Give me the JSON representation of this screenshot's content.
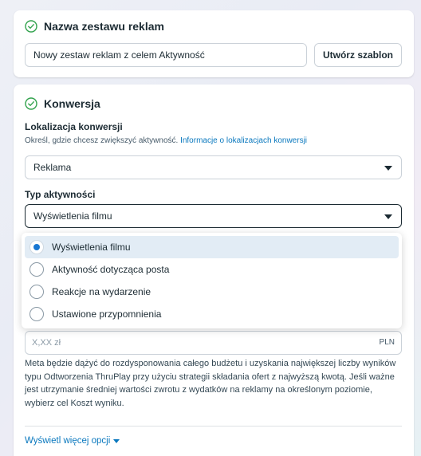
{
  "ad_set_name": {
    "title": "Nazwa zestawu reklam",
    "value": "Nowy zestaw reklam z celem Aktywność",
    "create_template_label": "Utwórz szablon"
  },
  "conversion": {
    "title": "Konwersja",
    "location_label": "Lokalizacja konwersji",
    "location_helper": "Określ, gdzie chcesz zwiększyć aktywność.",
    "location_helper_link": "Informacje o lokalizacjach konwersji",
    "location_value": "Reklama",
    "activity_label": "Typ aktywności",
    "activity_value": "Wyświetlenia filmu",
    "activity_options": [
      {
        "label": "Wyświetlenia filmu",
        "selected": true
      },
      {
        "label": "Aktywność dotycząca posta",
        "selected": false
      },
      {
        "label": "Reakcje na wydarzenie",
        "selected": false
      },
      {
        "label": "Ustawione przypomnienia",
        "selected": false
      }
    ],
    "amount_placeholder": "X,XX zł",
    "currency": "PLN",
    "description": "Meta będzie dążyć do rozdysponowania całego budżetu i uzyskania największej liczby wyników typu Odtworzenia ThruPlay przy użyciu strategii składania ofert z najwyższą kwotą. Jeśli ważne jest utrzymanie średniej wartości zwrotu z wydatków na reklamy na określonym poziomie, wybierz cel Koszt wyniku.",
    "more_options_label": "Wyświetl więcej opcji"
  },
  "colors": {
    "accent": "#1877d2",
    "link": "#0a78be",
    "success": "#31a24c"
  },
  "icons": {
    "section_status": "check-circle-icon",
    "select_caret": "caret-down-icon"
  }
}
